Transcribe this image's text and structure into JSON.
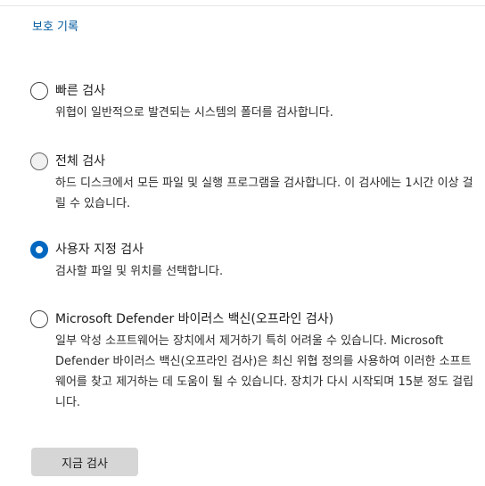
{
  "header": {
    "history_link": "보호 기록"
  },
  "scan_options": [
    {
      "label": "빠른 검사",
      "description": "위협이 일반적으로 발견되는 시스템의 폴더를 검사합니다.",
      "selected": false
    },
    {
      "label": "전체 검사",
      "description": "하드 디스크에서 모든 파일 및 실행 프로그램을 검사합니다. 이 검사에는 1시간 이상 걸릴 수 있습니다.",
      "selected": false
    },
    {
      "label": "사용자 지정 검사",
      "description": "검사할 파일 및 위치를 선택합니다.",
      "selected": true
    },
    {
      "label": "Microsoft Defender 바이러스 백신(오프라인 검사)",
      "description": "일부 악성 소프트웨어는 장치에서 제거하기 특히 어려울 수 있습니다. Microsoft Defender 바이러스 백신(오프라인 검사)은 최신 위협 정의를 사용하여 이러한 소프트웨어를 찾고 제거하는 데 도움이 될 수 있습니다. 장치가 다시 시작되며 15분 정도 걸립니다.",
      "selected": false
    }
  ],
  "actions": {
    "scan_now": "지금 검사"
  },
  "colors": {
    "accent": "#0067c0",
    "link": "#005a9e",
    "button_bg": "#d6d6d6"
  }
}
